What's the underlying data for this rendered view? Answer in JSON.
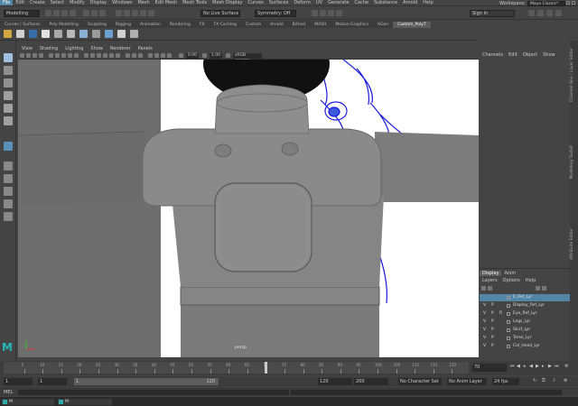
{
  "menubar": {
    "items": [
      "File",
      "Edit",
      "Create",
      "Select",
      "Modify",
      "Display",
      "Windows",
      "Mesh",
      "Edit Mesh",
      "Mesh Tools",
      "Mesh Display",
      "Curves",
      "Surfaces",
      "Deform",
      "UV",
      "Generate",
      "Cache",
      "Substance",
      "Arnold",
      "Help"
    ],
    "workspace_label": "Workspace:",
    "workspace_value": "Maya Classic*"
  },
  "status_line": {
    "mode": "Modelling",
    "live_surface": "No Live Surface",
    "symmetry": "Symmetry: Off",
    "sign_in": "Sign In"
  },
  "shelf_tabs": [
    "Curves / Surfaces",
    "Poly Modelling",
    "Sculpting",
    "Rigging",
    "Animation",
    "Rendering",
    "FX",
    "FX Caching",
    "Custom",
    "Arnold",
    "Bifrost",
    "MASH",
    "Motion Graphics",
    "XGen",
    "Custom_PolyT"
  ],
  "shelf_active": "Custom_PolyT",
  "viewport": {
    "menu": [
      "View",
      "Shading",
      "Lighting",
      "Show",
      "Renderer",
      "Panels"
    ],
    "near_value": "0.00",
    "far_value": "1.00",
    "color_space": "sRGB gamma",
    "camera_label": "persp"
  },
  "channel_box": {
    "tabs": [
      "Channels",
      "Edit",
      "Object",
      "Show"
    ]
  },
  "side_tabs": [
    "Channel Box / Layer Editor",
    "Modelling Toolkit",
    "Attribute Editor"
  ],
  "layer_panel": {
    "tabs": [
      "Display",
      "Anim"
    ],
    "menu": [
      "Layers",
      "Options",
      "Help"
    ],
    "rows": [
      {
        "v": "",
        "p": "",
        "r": "",
        "name": "E_Ref_Lyr",
        "selected": true
      },
      {
        "v": "V",
        "p": "P",
        "r": "",
        "name": "Display_Ref_Lyr",
        "selected": false
      },
      {
        "v": "V",
        "p": "P",
        "r": "R",
        "name": "Eye_Ref_Lyr",
        "selected": false
      },
      {
        "v": "V",
        "p": "P",
        "r": "",
        "name": "Legs_Lyr",
        "selected": false
      },
      {
        "v": "V",
        "p": "P",
        "r": "",
        "name": "Skirt_Lyr",
        "selected": false
      },
      {
        "v": "V",
        "p": "P",
        "r": "",
        "name": "Torso_Lyr",
        "selected": false
      },
      {
        "v": "V",
        "p": "P",
        "r": "",
        "name": "Col_Head_Lyr",
        "selected": false
      }
    ]
  },
  "time_slider": {
    "ticks": [
      "5",
      "10",
      "15",
      "20",
      "25",
      "30",
      "35",
      "40",
      "45",
      "50",
      "55",
      "60",
      "65",
      "70",
      "75",
      "80",
      "85",
      "90",
      "95",
      "100",
      "105",
      "110",
      "115",
      "120"
    ],
    "current_frame": "70",
    "end_value": "70"
  },
  "range_slider": {
    "start": "1",
    "start2": "1",
    "range_start": "1",
    "range_end": "120",
    "end": "120",
    "end2": "200",
    "character_set": "No Character Set",
    "anim_layer": "No Anim Layer",
    "fps": "24 fps"
  },
  "command_line": {
    "label": "MEL"
  },
  "taskbar": {
    "items": [
      "M",
      "M"
    ]
  },
  "logo_text": "M",
  "colors": {
    "accent": "#5285a6",
    "maya_teal": "#26b7bc",
    "viewport_bg": "#ffffff",
    "model_gray": "#7a7a7a",
    "sketch_blue": "#1a1adc"
  }
}
